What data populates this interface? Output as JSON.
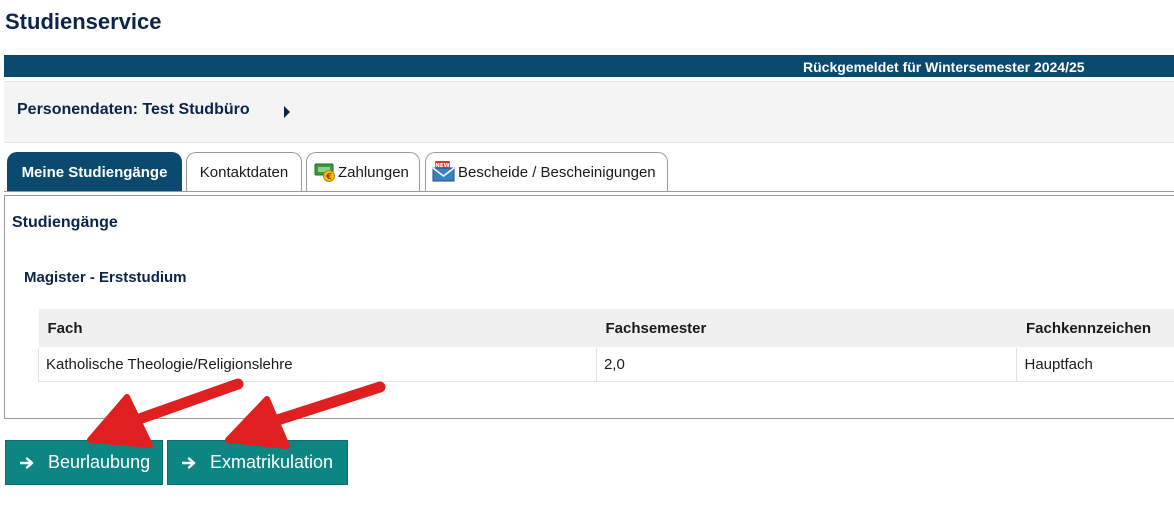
{
  "page": {
    "title": "Studienservice"
  },
  "status_bar": {
    "text": "Rückgemeldet für Wintersemester 2024/25"
  },
  "person": {
    "label": "Personendaten: Test Studbüro",
    "expand_icon": "chevron-right-icon"
  },
  "tabs": [
    {
      "label": "Meine Studiengänge",
      "active": true
    },
    {
      "label": "Kontaktdaten",
      "active": false
    },
    {
      "label": "Zahlungen",
      "active": false,
      "icon": "payment-euro-icon"
    },
    {
      "label": "Bescheide / Bescheinigungen",
      "active": false,
      "icon": "new-mail-icon",
      "icon_badge": "NEW"
    }
  ],
  "section": {
    "title": "Studiengänge",
    "degree_title": "Magister - Erststudium",
    "table": {
      "headers": [
        "Fach",
        "Fachsemester",
        "Fachkennzeichen"
      ],
      "rows": [
        [
          "Katholische Theologie/Religionslehre",
          "2,0",
          "Hauptfach"
        ]
      ]
    }
  },
  "actions": {
    "leave_label": "Beurlaubung",
    "exmatriculation_label": "Exmatrikulation",
    "button_icon": "arrow-right-icon"
  },
  "colors": {
    "header_bar": "#0a4a6e",
    "title": "#0c2448",
    "button": "#0d8683",
    "annotation_arrow": "#e02020"
  }
}
